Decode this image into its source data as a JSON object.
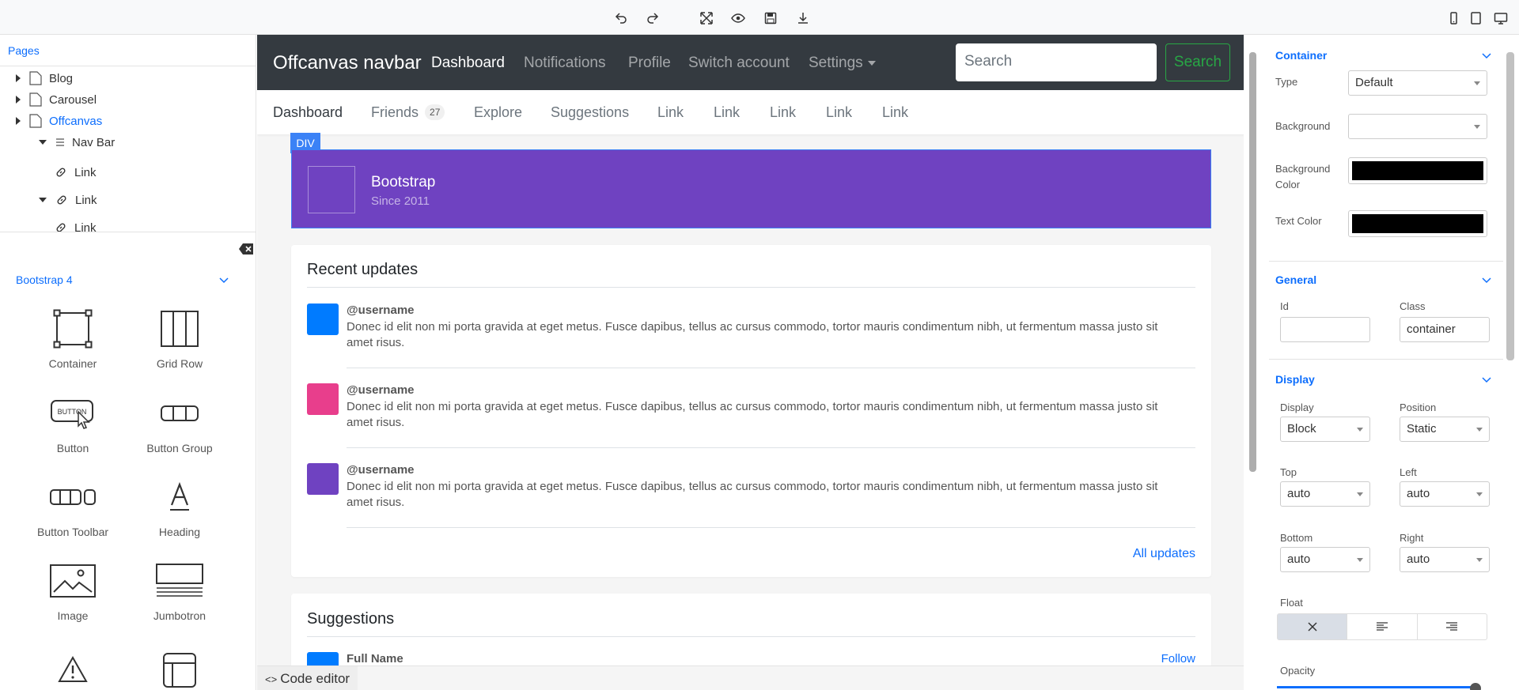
{
  "toolbar": {
    "icons": [
      "undo-icon",
      "redo-icon",
      "fullscreen-icon",
      "preview-icon",
      "save-icon",
      "download-icon",
      "mobile-icon",
      "tablet-icon",
      "desktop-icon"
    ]
  },
  "pages_panel": {
    "title": "Pages",
    "tree": [
      {
        "label": "Blog"
      },
      {
        "label": "Carousel"
      },
      {
        "label": "Offcanvas"
      },
      {
        "label": "Nav Bar"
      },
      {
        "label": "Link"
      },
      {
        "label": "Link"
      },
      {
        "label": "Link"
      }
    ]
  },
  "components_panel": {
    "title": "Bootstrap 4",
    "items": [
      {
        "label": "Container"
      },
      {
        "label": "Grid Row"
      },
      {
        "label": "Button",
        "icon_text": "BUTTON"
      },
      {
        "label": "Button Group"
      },
      {
        "label": "Button Toolbar"
      },
      {
        "label": "Heading"
      },
      {
        "label": "Image"
      },
      {
        "label": "Jumbotron"
      }
    ]
  },
  "canvas": {
    "navbar": {
      "brand": "Offcanvas navbar",
      "links": [
        "Dashboard",
        "Notifications",
        "Profile",
        "Switch account",
        "Settings"
      ],
      "search_placeholder": "Search",
      "search_button": "Search"
    },
    "subnav": {
      "links": [
        "Dashboard",
        "Friends",
        "Explore",
        "Suggestions",
        "Link",
        "Link",
        "Link",
        "Link",
        "Link"
      ],
      "friends_badge": "27"
    },
    "selected_label": "DIV",
    "brand_bar": {
      "title": "Bootstrap",
      "subtitle": "Since 2011",
      "color": "#6f42c1"
    },
    "recent_updates": {
      "title": "Recent updates",
      "items": [
        {
          "user": "@username",
          "text": "Donec id elit non mi porta gravida at eget metus. Fusce dapibus, tellus ac cursus commodo, tortor mauris condimentum nibh, ut fermentum massa justo sit amet risus.",
          "color": "#007bff"
        },
        {
          "user": "@username",
          "text": "Donec id elit non mi porta gravida at eget metus. Fusce dapibus, tellus ac cursus commodo, tortor mauris condimentum nibh, ut fermentum massa justo sit amet risus.",
          "color": "#e83e8c"
        },
        {
          "user": "@username",
          "text": "Donec id elit non mi porta gravida at eget metus. Fusce dapibus, tellus ac cursus commodo, tortor mauris condimentum nibh, ut fermentum massa justo sit amet risus.",
          "color": "#6f42c1"
        }
      ],
      "all_link": "All updates"
    },
    "suggestions": {
      "title": "Suggestions",
      "first_name": "Full Name",
      "follow": "Follow"
    },
    "code_editor": "Code editor"
  },
  "properties": {
    "container": {
      "title": "Container",
      "type_label": "Type",
      "type_value": "Default",
      "background_label": "Background",
      "background_value": "",
      "bg_color_label": "Background Color",
      "bg_color": "#000000",
      "text_color_label": "Text Color",
      "text_color": "#000000"
    },
    "general": {
      "title": "General",
      "id_label": "Id",
      "id_value": "",
      "class_label": "Class",
      "class_value": "container"
    },
    "display": {
      "title": "Display",
      "display_label": "Display",
      "display_value": "Block",
      "position_label": "Position",
      "position_value": "Static",
      "top_label": "Top",
      "top_value": "auto",
      "left_label": "Left",
      "left_value": "auto",
      "bottom_label": "Bottom",
      "bottom_value": "auto",
      "right_label": "Right",
      "right_value": "auto",
      "float_label": "Float",
      "opacity_label": "Opacity"
    }
  }
}
